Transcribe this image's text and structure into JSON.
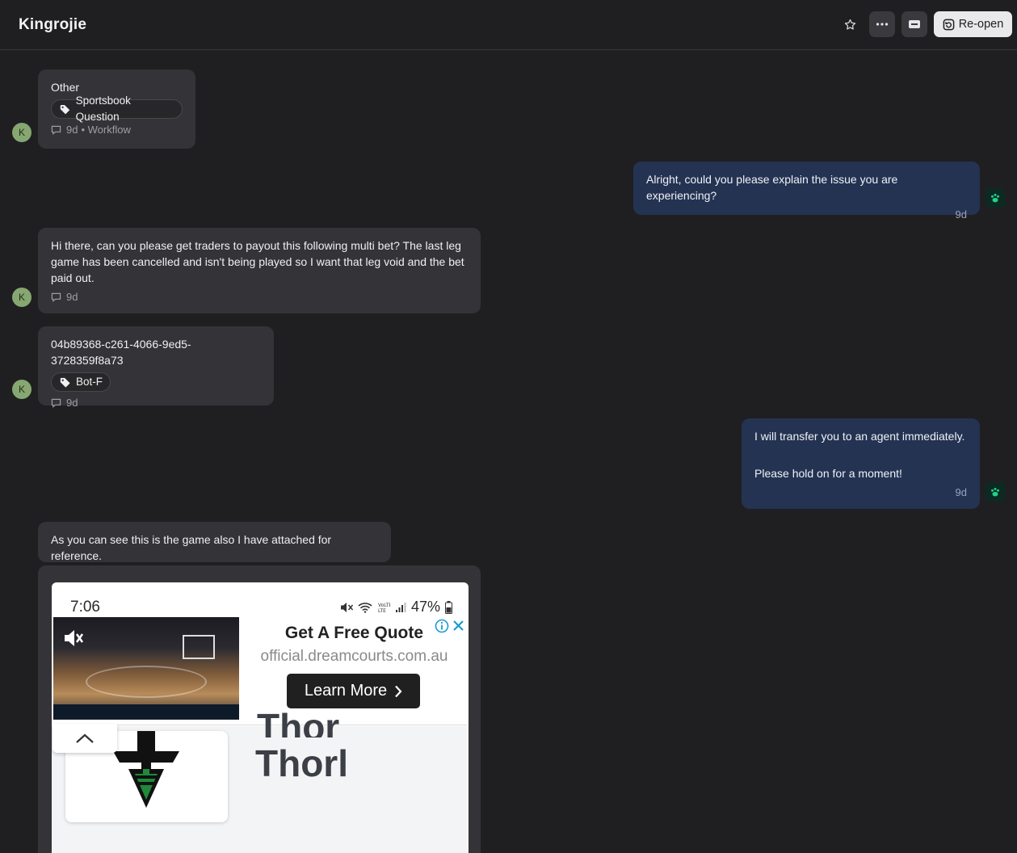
{
  "header": {
    "title": "Kingrojie",
    "reopen_label": "Re-open",
    "icons": [
      "star-icon",
      "more-icon",
      "ticket-icon",
      "reopen-icon"
    ]
  },
  "messages": {
    "m1": {
      "avatar": "K",
      "text": "Other",
      "tag": "Sportsbook Question",
      "time": "9d",
      "source": "• Workflow"
    },
    "m2": {
      "text": "Alright, could you please explain the issue you are experiencing?",
      "time": "9d"
    },
    "m3": {
      "avatar": "K",
      "text": "Hi there, can you please get traders to payout this following multi bet? The last leg game has been cancelled and isn't being played so I want that leg void and the bet paid out.",
      "time": "9d"
    },
    "m4": {
      "avatar": "K",
      "text": "04b89368-c261-4066-9ed5-3728359f8a73",
      "tag": "Bot-F",
      "time": "9d"
    },
    "m5": {
      "line1": "I will transfer you to an agent immediately.",
      "line2": "Please hold on for a moment!",
      "time": "9d"
    },
    "m6": {
      "text": "As you can see this is the game also I have attached for reference."
    }
  },
  "attachment": {
    "status_time": "7:06",
    "battery": "47%",
    "ad_headline": "Get A Free Quote",
    "ad_url": "official.dreamcourts.com.au",
    "ad_cta": "Learn More",
    "page_text_partial": "Thor",
    "page_text": "Thorl"
  },
  "colors": {
    "background": "#1f1f21",
    "incoming_bubble": "#343438",
    "outgoing_bubble": "#253352",
    "avatar": "#86a771",
    "bot_accent": "#1fd28a"
  }
}
